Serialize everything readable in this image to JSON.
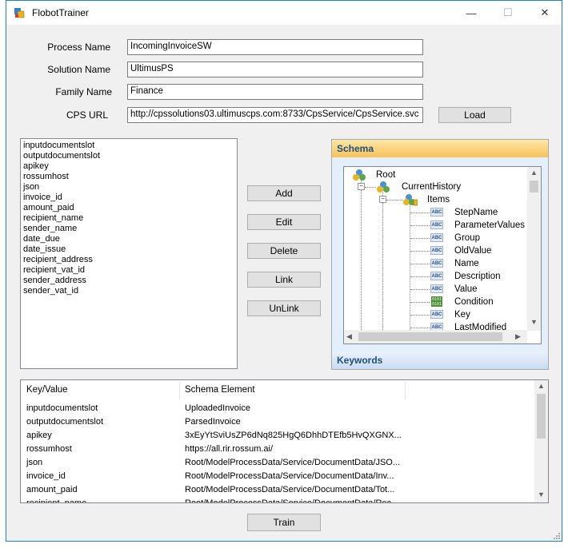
{
  "window": {
    "title": "FlobotTrainer",
    "minimize": "—",
    "maximize": "☐",
    "close": "✕"
  },
  "form": {
    "process_name_label": "Process Name",
    "process_name_value": "IncomingInvoiceSW",
    "solution_name_label": "Solution Name",
    "solution_name_value": "UltimusPS",
    "family_name_label": "Family Name",
    "family_name_value": "Finance",
    "cps_url_label": "CPS URL",
    "cps_url_value": "http://cpssolutions03.ultimuscps.com:8733/CpsService/CpsService.svc",
    "load_button": "Load"
  },
  "variables": [
    "inputdocumentslot",
    "outputdocumentslot",
    "apikey",
    "rossumhost",
    "json",
    "invoice_id",
    "amount_paid",
    "recipient_name",
    "sender_name",
    "date_due",
    "date_issue",
    "recipient_address",
    "recipient_vat_id",
    "sender_address",
    "sender_vat_id"
  ],
  "actions": {
    "add": "Add",
    "edit": "Edit",
    "delete": "Delete",
    "link": "Link",
    "unlink": "UnLink"
  },
  "schema": {
    "header": "Schema",
    "keywords_header": "Keywords",
    "root": "Root",
    "history": "CurrentHistory",
    "items": "Items",
    "fields": [
      {
        "name": "StepName",
        "type": "ABC"
      },
      {
        "name": "ParameterValues",
        "type": "ABC"
      },
      {
        "name": "Group",
        "type": "ABC"
      },
      {
        "name": "OldValue",
        "type": "ABC"
      },
      {
        "name": "Name",
        "type": "ABC"
      },
      {
        "name": "Description",
        "type": "ABC"
      },
      {
        "name": "Value",
        "type": "ABC"
      },
      {
        "name": "Condition",
        "type": "0101"
      },
      {
        "name": "Key",
        "type": "ABC"
      },
      {
        "name": "LastModified",
        "type": "ABC"
      }
    ]
  },
  "mapping": {
    "col_key": "Key/Value",
    "col_schema": "Schema Element",
    "rows": [
      {
        "key": "inputdocumentslot",
        "value": "UploadedInvoice"
      },
      {
        "key": "outputdocumentslot",
        "value": "ParsedInvoice"
      },
      {
        "key": "apikey",
        "value": "3xEyYtSviUsZP6dNq825HgQ6DhhDTEfb5HvQXGNX..."
      },
      {
        "key": "rossumhost",
        "value": "https://all.rir.rossum.ai/"
      },
      {
        "key": "json",
        "value": "Root/ModelProcessData/Service/DocumentData/JSO..."
      },
      {
        "key": "invoice_id",
        "value": "Root/ModelProcessData/Service/DocumentData/Inv..."
      },
      {
        "key": "amount_paid",
        "value": "Root/ModelProcessData/Service/DocumentData/Tot..."
      },
      {
        "key": "recipient_name",
        "value": "Root/ModelProcessData/Service/DocumentData/Rec..."
      }
    ]
  },
  "train_button": "Train",
  "colors": {
    "window_border": "#1883d7",
    "schema_header": "#f9c25a",
    "keywords_header": "#c9dcf2",
    "header_text": "#1f4e79"
  }
}
